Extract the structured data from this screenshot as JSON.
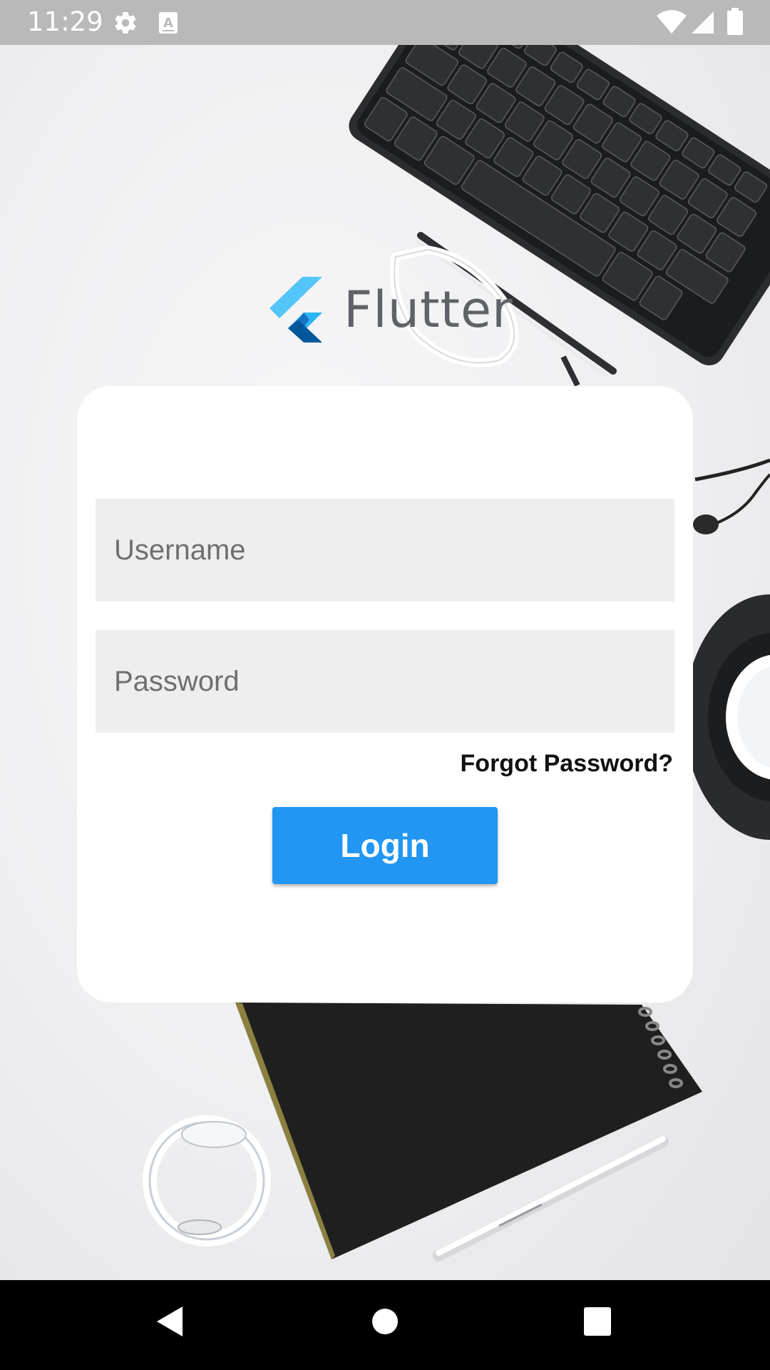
{
  "status_bar": {
    "time": "11:29",
    "icons": [
      "gear-icon",
      "keyboard-a-icon",
      "wifi-icon",
      "signal-icon",
      "battery-icon"
    ]
  },
  "logo": {
    "text": "Flutter",
    "colors": {
      "light_blue": "#54c5f8",
      "mid_blue": "#29b6f6",
      "dark_blue": "#01579b"
    }
  },
  "login": {
    "username_placeholder": "Username",
    "password_placeholder": "Password",
    "forgot_label": "Forgot Password?",
    "login_label": "Login"
  },
  "colors": {
    "accent": "#2196f3",
    "field_bg": "#eeeeee",
    "card_bg": "#ffffff"
  },
  "nav_bar": {
    "buttons": [
      "back-icon",
      "home-icon",
      "recents-icon"
    ]
  }
}
